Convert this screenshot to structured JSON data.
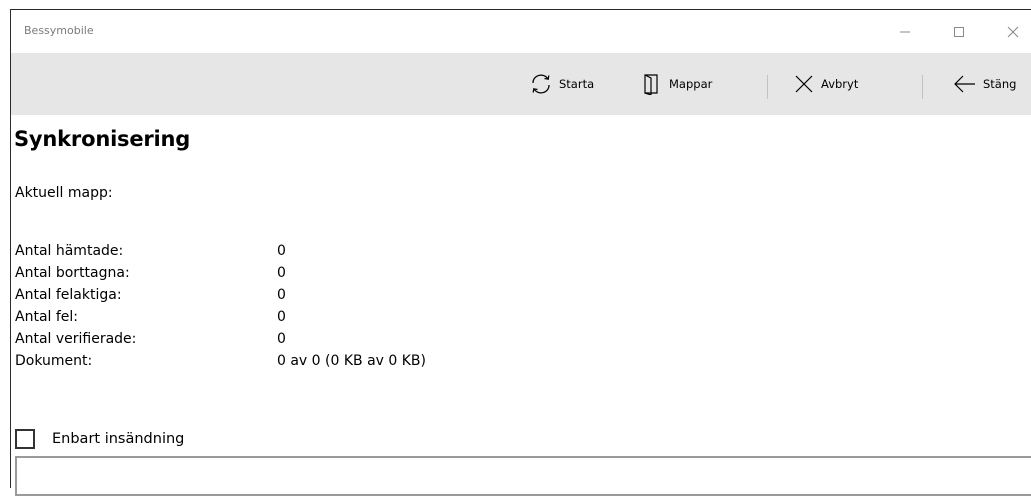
{
  "window": {
    "title": "Bessymobile"
  },
  "toolbar": {
    "start_label": "Starta",
    "folders_label": "Mappar",
    "cancel_label": "Avbryt",
    "close_label": "Stäng"
  },
  "page": {
    "title": "Synkronisering",
    "current_folder_label": "Aktuell mapp:",
    "current_folder_value": ""
  },
  "stats": [
    {
      "label": "Antal hämtade:",
      "value": "0"
    },
    {
      "label": "Antal borttagna:",
      "value": "0"
    },
    {
      "label": "Antal felaktiga:",
      "value": "0"
    },
    {
      "label": "Antal fel:",
      "value": "0"
    },
    {
      "label": "Antal verifierade:",
      "value": "0"
    },
    {
      "label": "Dokument:",
      "value": "0 av 0 (0 KB av 0 KB)"
    }
  ],
  "options": {
    "only_submit_label": "Enbart insändning",
    "only_submit_checked": false
  },
  "log": {
    "value": ""
  },
  "colors": {
    "commandbar_bg": "#e6e6e6",
    "window_bg": "#ffffff",
    "title_text": "#7a7a7a"
  }
}
